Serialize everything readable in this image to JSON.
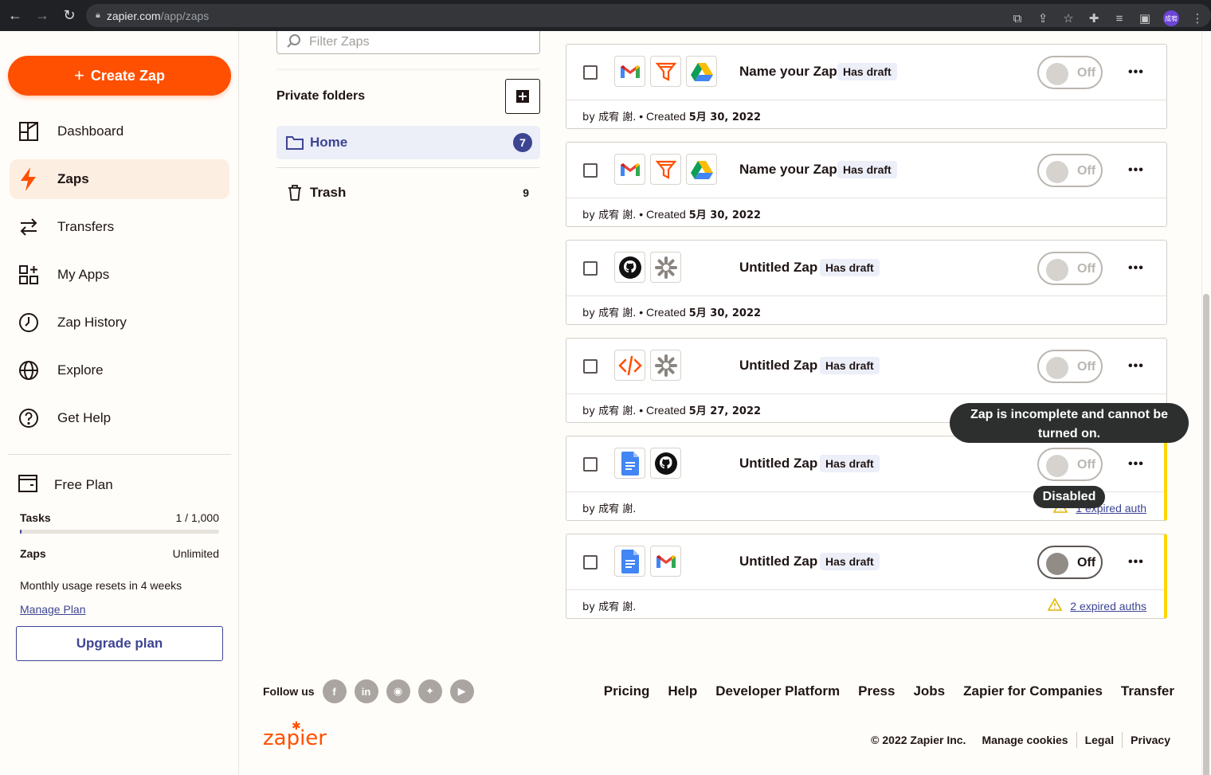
{
  "browser": {
    "url_host": "zapier.com",
    "url_path": "/app/zaps",
    "avatar_text": "成宥"
  },
  "sidebar": {
    "create_label": "Create Zap",
    "items": [
      {
        "label": "Dashboard",
        "icon": "dashboard-icon"
      },
      {
        "label": "Zaps",
        "icon": "bolt-icon",
        "active": true
      },
      {
        "label": "Transfers",
        "icon": "transfer-arrows-icon"
      },
      {
        "label": "My Apps",
        "icon": "apps-grid-icon"
      },
      {
        "label": "Zap History",
        "icon": "clock-icon"
      },
      {
        "label": "Explore",
        "icon": "globe-icon"
      },
      {
        "label": "Get Help",
        "icon": "help-icon"
      }
    ],
    "plan": {
      "name": "Free Plan",
      "tasks_label": "Tasks",
      "tasks_value": "1 / 1,000",
      "tasks_used_fraction": 0.001,
      "zaps_label": "Zaps",
      "zaps_value": "Unlimited",
      "reset_text": "Monthly usage resets in 4 weeks",
      "manage_link": "Manage Plan",
      "upgrade_label": "Upgrade plan"
    }
  },
  "folders": {
    "filter_placeholder": "Filter Zaps",
    "title": "Private folders",
    "items": [
      {
        "name": "Home",
        "count": "7",
        "active": true
      },
      {
        "name": "Trash",
        "count": "9"
      }
    ]
  },
  "zaps": [
    {
      "apps": [
        "gmail",
        "filter",
        "google-drive"
      ],
      "name": "Name your Zap",
      "badge": "Has draft",
      "toggle": "Off",
      "by": "by 成宥 謝.",
      "created_label": "Created",
      "created_date": "5月 30, 2022",
      "warning": ""
    },
    {
      "apps": [
        "gmail",
        "filter",
        "google-drive"
      ],
      "name": "Name your Zap",
      "badge": "Has draft",
      "toggle": "Off",
      "by": "by 成宥 謝.",
      "created_label": "Created",
      "created_date": "5月 30, 2022",
      "warning": ""
    },
    {
      "apps": [
        "github",
        "zapier-asterisk"
      ],
      "name": "Untitled Zap",
      "badge": "Has draft",
      "toggle": "Off",
      "by": "by 成宥 謝.",
      "created_label": "Created",
      "created_date": "5月 30, 2022",
      "warning": ""
    },
    {
      "apps": [
        "code",
        "zapier-asterisk"
      ],
      "name": "Untitled Zap",
      "badge": "Has draft",
      "toggle": "Off",
      "by": "by 成宥 謝.",
      "created_label": "Created",
      "created_date": "5月 27, 2022",
      "warning": ""
    },
    {
      "apps": [
        "google-docs",
        "github"
      ],
      "name": "Untitled Zap",
      "badge": "Has draft",
      "toggle": "Off",
      "by": "by 成宥 謝.",
      "created_label": "",
      "created_date": "",
      "warning": "1 expired auth"
    },
    {
      "apps": [
        "google-docs",
        "gmail"
      ],
      "name": "Untitled Zap",
      "badge": "Has draft",
      "toggle": "Off",
      "toggle_enabled": true,
      "by": "by 成宥 謝.",
      "created_label": "",
      "created_date": "",
      "warning": "2 expired auths"
    }
  ],
  "tooltips": {
    "incomplete": "Zap is incomplete and cannot be turned on.",
    "disabled": "Disabled"
  },
  "footer": {
    "follow_label": "Follow us",
    "social": [
      "facebook-icon",
      "linkedin-icon",
      "rss-icon",
      "twitter-icon",
      "youtube-icon"
    ],
    "links": [
      "Pricing",
      "Help",
      "Developer Platform",
      "Press",
      "Jobs",
      "Zapier for Companies",
      "Transfer"
    ],
    "logo_text": "zapier",
    "copyright": "© 2022 Zapier Inc.",
    "bottom_links": [
      "Manage cookies",
      "Legal",
      "Privacy"
    ]
  },
  "colors": {
    "brand_orange": "#ff4f00",
    "accent_blue": "#3d4592",
    "warning_yellow": "#ffd600"
  }
}
